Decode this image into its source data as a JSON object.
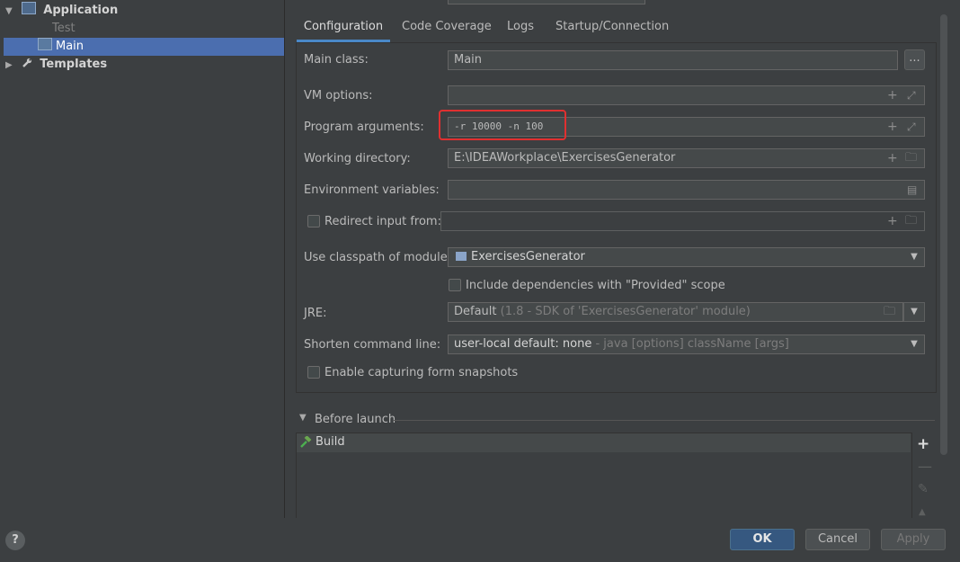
{
  "tree": {
    "application": "Application",
    "test": "Test",
    "main": "Main",
    "templates": "Templates"
  },
  "tabs": [
    "Configuration",
    "Code Coverage",
    "Logs",
    "Startup/Connection"
  ],
  "form": {
    "main_class_label": "Main class:",
    "main_class_value": "Main",
    "browse_label": "...",
    "vm_options_label": "VM options:",
    "vm_options_value": "",
    "program_args_label": "Program arguments:",
    "program_args_value": "-r 10000 -n 100",
    "working_dir_label": "Working directory:",
    "working_dir_value": "E:\\IDEAWorkplace\\ExercisesGenerator",
    "env_vars_label": "Environment variables:",
    "env_vars_value": "",
    "redirect_label": "Redirect input from:",
    "redirect_value": "",
    "classpath_label": "Use classpath of module:",
    "classpath_value": "ExercisesGenerator",
    "include_deps_label": "Include dependencies with \"Provided\" scope",
    "jre_label": "JRE:",
    "jre_value": "Default",
    "jre_hint": "(1.8 - SDK of 'ExercisesGenerator' module)",
    "shorten_label": "Shorten command line:",
    "shorten_value": "user-local default: none",
    "shorten_hint": "- java [options] className [args]",
    "snapshots_label": "Enable capturing form snapshots"
  },
  "before_launch": {
    "title": "Before launch",
    "items": [
      "Build"
    ]
  },
  "buttons": {
    "ok": "OK",
    "cancel": "Cancel",
    "apply": "Apply",
    "help": "?"
  },
  "colors": {
    "background": "#3c3f41",
    "selection": "#4b6eaf",
    "accent": "#4a88c7",
    "highlight": "#e03030"
  }
}
